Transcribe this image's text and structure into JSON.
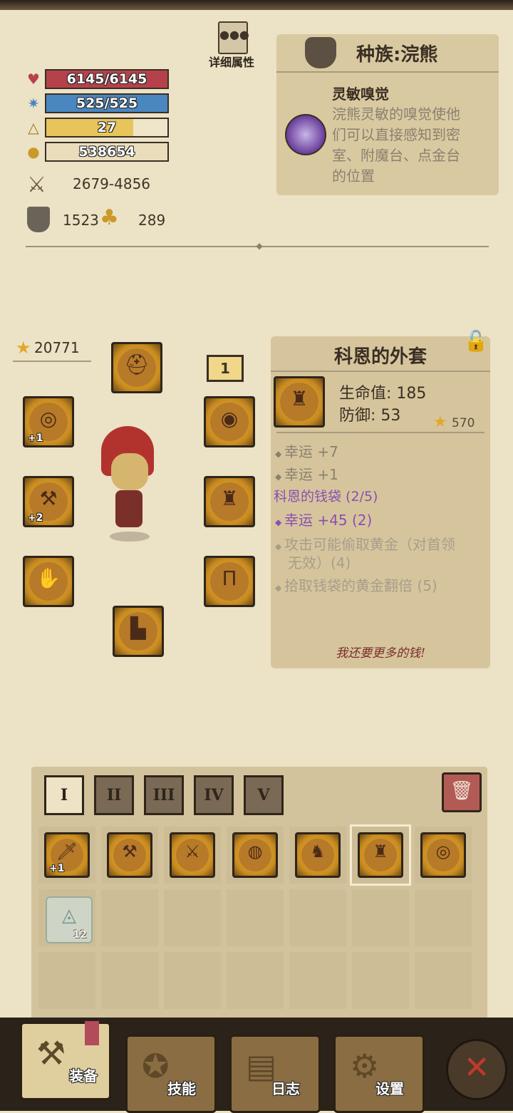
{
  "header": {
    "details_label": "详细属性"
  },
  "stats": {
    "hp": "6145/6145",
    "mp": "525/525",
    "level": "27",
    "gold": "538654",
    "attack": "2679-4856",
    "defense": "1523",
    "luck": "289"
  },
  "race": {
    "title": "种族:浣熊",
    "skill_name": "灵敏嗅觉",
    "skill_desc_lines": [
      "浣熊灵敏的嗅觉使他",
      "们可以直接感知到密",
      "室、附魔台、点金台",
      "的位置"
    ]
  },
  "equipment": {
    "star_score": "20771",
    "slot_badge": "1",
    "ring_plus": "+1",
    "weapon_plus": "+2"
  },
  "item": {
    "name": "科恩的外套",
    "stat_hp": "生命值: 185",
    "stat_def": "防御: 53",
    "score": "570",
    "effects": [
      "幸运 +7",
      "幸运 +1"
    ],
    "set_title": "科恩的钱袋 (2/5)",
    "set_bonuses": [
      {
        "text": "幸运 +45 (2)",
        "active": true
      },
      {
        "text": "攻击可能偷取黄金（对首领",
        "active": false
      },
      {
        "text": "无效）(4)",
        "active": false
      },
      {
        "text": "拾取钱袋的黄金翻倍 (5)",
        "active": false
      }
    ],
    "flavor": "我还要更多的钱!"
  },
  "inventory": {
    "tabs": [
      "I",
      "II",
      "III",
      "IV",
      "V"
    ],
    "items": [
      "sword-icon",
      "axe-icon",
      "dagger-icon",
      "scarf-icon",
      "cape-icon",
      "coat-icon",
      "ring-icon"
    ],
    "first_plus": "+1",
    "scroll_count": "12"
  },
  "nav": {
    "equip": "装备",
    "skills": "技能",
    "log": "日志",
    "settings": "设置"
  },
  "colors": {
    "hp": "#b5424b",
    "mp": "#4a86c0",
    "level": "#e8c55a",
    "gold_bar": "#e9ddbc",
    "accent_purple": "#8a4fb0",
    "close_red": "#c0392b"
  }
}
